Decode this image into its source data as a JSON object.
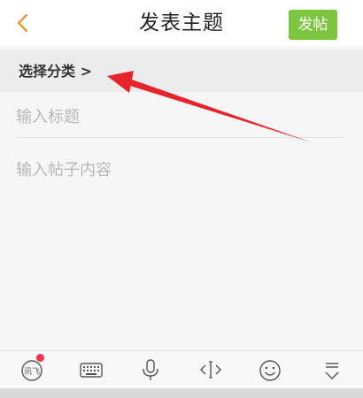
{
  "header": {
    "title": "发表主题",
    "publish_label": "发帖"
  },
  "category": {
    "label": "选择分类 >"
  },
  "editor": {
    "title_placeholder": "输入标题",
    "body_placeholder": "输入帖子内容"
  },
  "toolbar": {
    "voice_input_label": "讯飞"
  },
  "colors": {
    "accent": "#f08a24",
    "publish_button": "#7cc540",
    "notification_dot": "#f4334a",
    "annotation_arrow": "#e8232c"
  }
}
